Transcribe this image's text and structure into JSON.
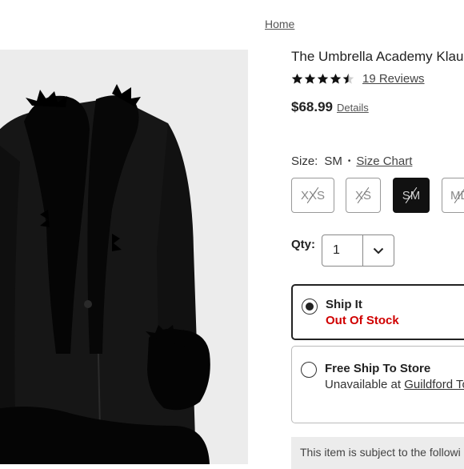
{
  "breadcrumb": {
    "home_label": "Home"
  },
  "product": {
    "title": "The Umbrella Academy Klaus",
    "rating": 4.5,
    "rating_max": 5,
    "reviews_label": "19 Reviews",
    "price": "$68.99",
    "details_label": "Details",
    "image_icon": "black-faux-leather-coat-with-fur-trim"
  },
  "size": {
    "label": "Size:",
    "selected": "SM",
    "separator": "•",
    "chart_label": "Size Chart",
    "options": [
      {
        "label": "XXS",
        "available": false,
        "selected": false
      },
      {
        "label": "XS",
        "available": false,
        "selected": false
      },
      {
        "label": "SM",
        "available": false,
        "selected": true
      },
      {
        "label": "MD",
        "available": false,
        "selected": false
      }
    ]
  },
  "quantity": {
    "label": "Qty:",
    "value": "1"
  },
  "fulfillment": {
    "ship": {
      "title": "Ship It",
      "status": "Out Of Stock",
      "selected": true,
      "status_color": "#d00000"
    },
    "store": {
      "title": "Free Ship To Store",
      "status_prefix": "Unavailable at",
      "store_name": "Guildford To",
      "selected": false
    }
  },
  "notice": "This item is subject to the followi"
}
